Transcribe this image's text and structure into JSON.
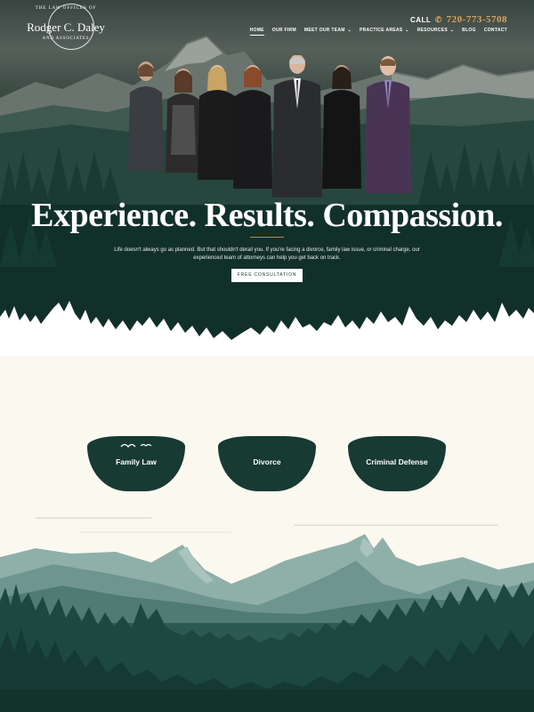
{
  "brand": {
    "ring_top": "THE LAW OFFICES OF",
    "name": "Rodger C. Daley",
    "ring_bottom": "AND ASSOCIATES"
  },
  "header": {
    "call_label": "CALL",
    "phone": "720-773-5708",
    "nav": [
      {
        "label": "HOME",
        "active": true,
        "dropdown": false
      },
      {
        "label": "OUR FIRM",
        "dropdown": false
      },
      {
        "label": "MEET OUR TEAM",
        "dropdown": true
      },
      {
        "label": "PRACTICE AREAS",
        "dropdown": true
      },
      {
        "label": "RESOURCES",
        "dropdown": true
      },
      {
        "label": "BLOG",
        "dropdown": false
      },
      {
        "label": "CONTACT",
        "dropdown": false
      }
    ]
  },
  "hero": {
    "headline": "Experience. Results. Compassion.",
    "intro": "Life doesn't always go as planned. But that shouldn't derail you. If you're facing a divorce, family law issue, or criminal charge, our experienced team of attorneys can help you get back on track.",
    "cta_label": "FREE CONSULTATION"
  },
  "practice_areas": [
    {
      "label": "Family Law"
    },
    {
      "label": "Divorce"
    },
    {
      "label": "Criminal Defense"
    }
  ],
  "colors": {
    "forest": "#173a33",
    "accent": "#d9a35c",
    "cream": "#fbf8f0"
  },
  "icons": {
    "phone": "phone-icon",
    "dropdown": "chevron-down-icon"
  }
}
